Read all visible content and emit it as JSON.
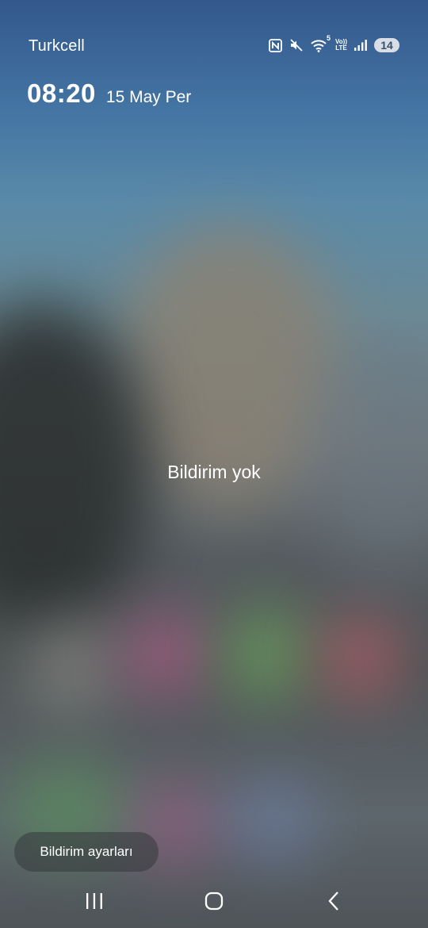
{
  "status_bar": {
    "carrier": "Turkcell",
    "icons": [
      "nfc-icon",
      "mute-icon",
      "wifi-icon",
      "volte-icon",
      "signal-icon"
    ],
    "wifi_badge": "5",
    "volte_top": "Vo))",
    "volte_bottom": "LTE",
    "battery_level": "14",
    "battery_color": "#d9dee6"
  },
  "clock": {
    "time": "08:20",
    "date": "15 May Per"
  },
  "notifications": {
    "empty_message": "Bildirim yok"
  },
  "actions": {
    "notification_settings_label": "Bildirim ayarları"
  },
  "navigation": {
    "buttons": [
      "recents-icon",
      "home-icon",
      "back-icon"
    ]
  }
}
